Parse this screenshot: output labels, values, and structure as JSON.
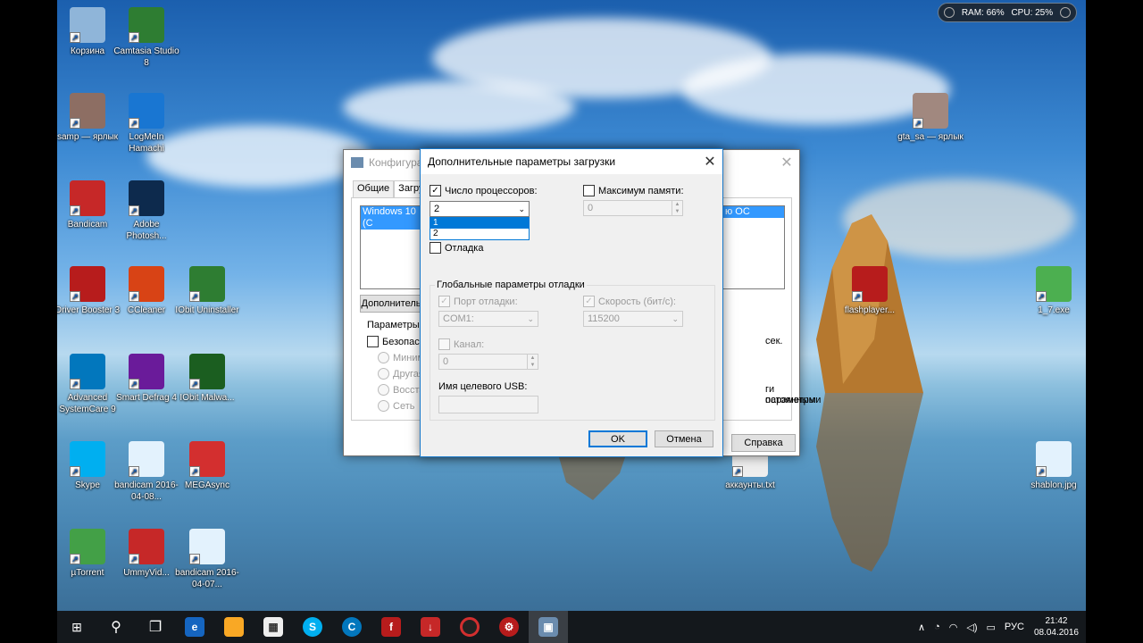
{
  "meter": {
    "ram": "RAM: 66%",
    "cpu": "CPU: 25%"
  },
  "desktop_icons": [
    {
      "label": "Корзина",
      "icon": "recycle-bin-icon",
      "color": "#8fb5d9"
    },
    {
      "label": "Camtasia Studio 8",
      "icon": "camtasia-icon",
      "color": "#2e7d32"
    },
    {
      "label": "samp — ярлык",
      "icon": "samp-icon",
      "color": "#8d6e63"
    },
    {
      "label": "LogMeIn Hamachi",
      "icon": "hamachi-icon",
      "color": "#1976d2"
    },
    {
      "label": "Bandicam",
      "icon": "bandicam-icon",
      "color": "#c62828"
    },
    {
      "label": "Adobe Photosh...",
      "icon": "photoshop-icon",
      "color": "#0d2a4d"
    },
    {
      "label": "Driver Booster 3",
      "icon": "driver-booster-icon",
      "color": "#b71c1c"
    },
    {
      "label": "CCleaner",
      "icon": "ccleaner-icon",
      "color": "#d84315"
    },
    {
      "label": "IObit Uninstaller",
      "icon": "iobit-uninstaller-icon",
      "color": "#2e7d32"
    },
    {
      "label": "Advanced SystemCare 9",
      "icon": "advanced-systemcare-icon",
      "color": "#0277bd"
    },
    {
      "label": "Smart Defrag 4",
      "icon": "smart-defrag-icon",
      "color": "#6a1b9a"
    },
    {
      "label": "IObit Malwa...",
      "icon": "iobit-malware-icon",
      "color": "#1b5e20"
    },
    {
      "label": "Skype",
      "icon": "skype-icon",
      "color": "#00aff0"
    },
    {
      "label": "bandicam 2016-04-08...",
      "icon": "video-file-icon",
      "color": "#e3f2fd"
    },
    {
      "label": "MEGAsync",
      "icon": "megasync-icon",
      "color": "#d32f2f"
    },
    {
      "label": "µTorrent",
      "icon": "utorrent-icon",
      "color": "#43a047"
    },
    {
      "label": "UmmyVid...",
      "icon": "ummy-video-icon",
      "color": "#c62828"
    },
    {
      "label": "bandicam 2016-04-07...",
      "icon": "video-file-icon",
      "color": "#e3f2fd"
    },
    {
      "label": "gta_sa — ярлык",
      "icon": "gta-sa-icon",
      "color": "#a1887f"
    },
    {
      "label": "flashplayer...",
      "icon": "flash-player-icon",
      "color": "#b71c1c"
    },
    {
      "label": "1_7.exe",
      "icon": "minecraft-icon",
      "color": "#4caf50"
    },
    {
      "label": "аккаунты.txt",
      "icon": "text-file-icon",
      "color": "#eeeeee"
    },
    {
      "label": "shablon.jpg",
      "icon": "image-file-icon",
      "color": "#e3f2fd"
    }
  ],
  "msconfig": {
    "title": "Конфигурац",
    "tabs": [
      "Общие",
      "Загру"
    ],
    "os_entry": "Windows 10 (C",
    "os_entry_right": "ю ОС",
    "advanced_btn": "Дополнитель",
    "params_label": "Параметры з",
    "safe_boot": "Безопасн",
    "radios": [
      "Миним",
      "Другая",
      "Восстан",
      "Сеть"
    ],
    "timeout_unit": "сек.",
    "persist_text_1": "ги параметры",
    "persist_text_2": "остоянными",
    "help_btn": "Справка"
  },
  "dialog": {
    "title": "Дополнительные параметры загрузки",
    "num_processors_label": "Число процессоров:",
    "num_processors_checked": true,
    "num_processors_value": "2",
    "num_processors_options": [
      "1",
      "2"
    ],
    "max_memory_label": "Максимум памяти:",
    "max_memory_value": "0",
    "debug_label": "Отладка",
    "global_debug_title": "Глобальные параметры отладки",
    "debug_port_label": "Порт отладки:",
    "debug_port_value": "COM1:",
    "speed_label": "Скорость (бит/с):",
    "speed_value": "115200",
    "channel_label": "Канал:",
    "channel_value": "0",
    "usb_label": "Имя целевого USB:",
    "ok": "OK",
    "cancel": "Отмена"
  },
  "taskbar": {
    "lang": "РУС",
    "time": "21:42",
    "date": "08.04.2016"
  }
}
